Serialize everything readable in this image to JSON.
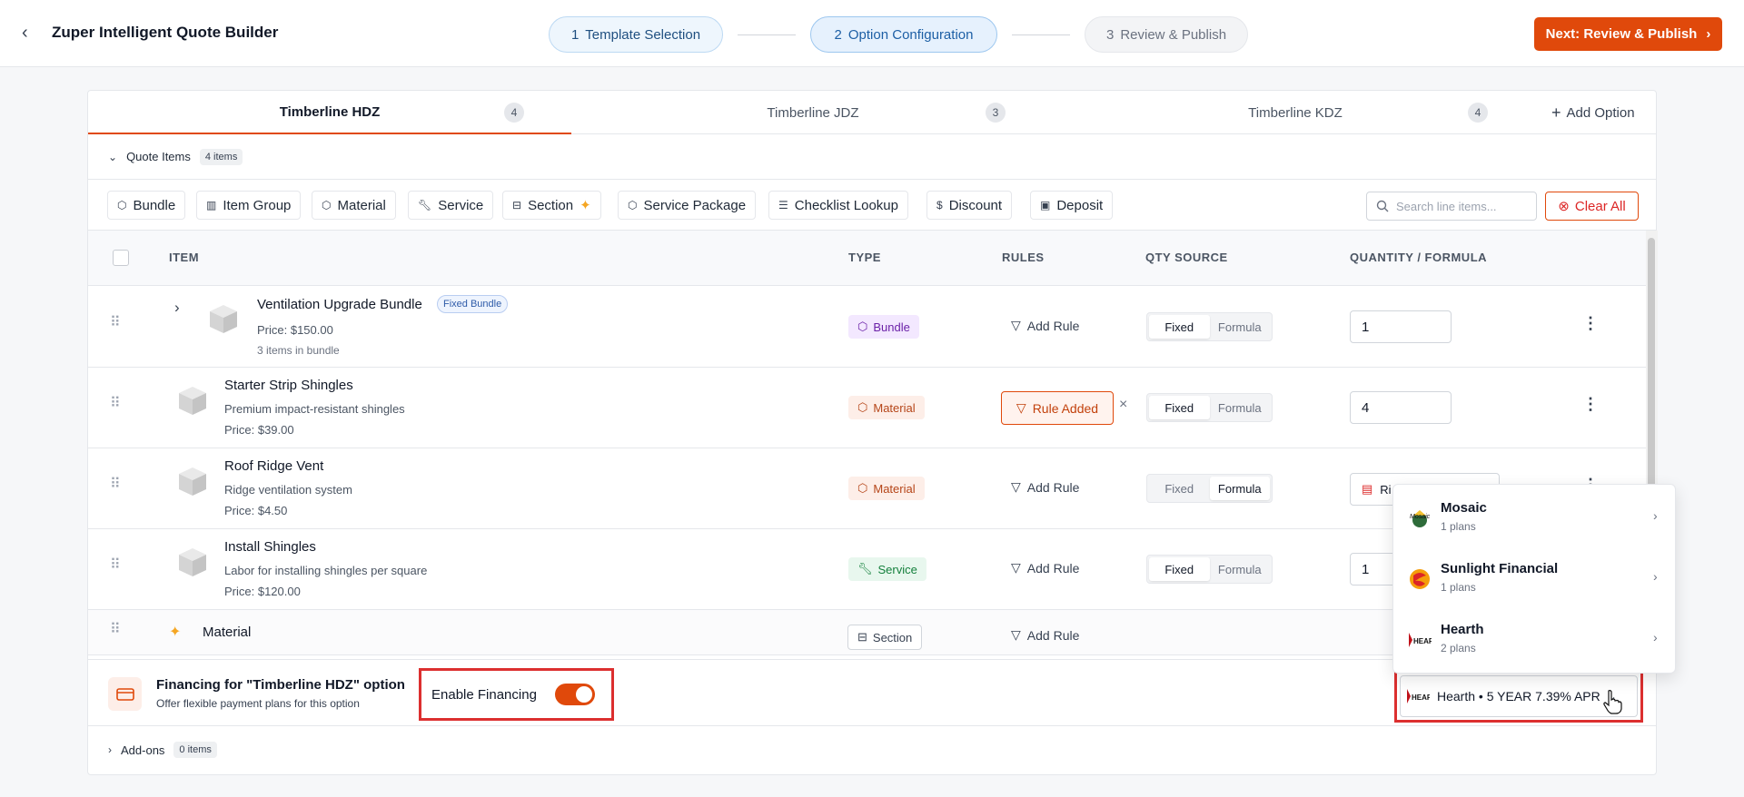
{
  "header": {
    "title": "Zuper Intelligent Quote Builder",
    "steps": [
      {
        "num": "1",
        "label": "Template Selection"
      },
      {
        "num": "2",
        "label": "Option Configuration"
      },
      {
        "num": "3",
        "label": "Review & Publish"
      }
    ],
    "next_button": "Next: Review & Publish"
  },
  "tabs": [
    {
      "label": "Timberline HDZ",
      "count": "4"
    },
    {
      "label": "Timberline JDZ",
      "count": "3"
    },
    {
      "label": "Timberline KDZ",
      "count": "4"
    }
  ],
  "add_option": "Add Option",
  "quote_items": {
    "label": "Quote Items",
    "count": "4 items"
  },
  "toolbar": [
    "Bundle",
    "Item Group",
    "Material",
    "Service",
    "Section",
    "Service Package",
    "Checklist Lookup",
    "Discount",
    "Deposit"
  ],
  "search": {
    "placeholder": "Search line items..."
  },
  "clear_all": "Clear All",
  "columns": [
    "ITEM",
    "TYPE",
    "RULES",
    "QTY SOURCE",
    "QUANTITY / FORMULA"
  ],
  "rows": [
    {
      "name": "Ventilation Upgrade Bundle",
      "badge": "Fixed Bundle",
      "price": "Price: $150.00",
      "sub": "3 items in bundle",
      "type": "Bundle",
      "rule": "Add Rule",
      "qty_source": "Fixed",
      "qty": "1"
    },
    {
      "name": "Starter Strip Shingles",
      "desc": "Premium impact-resistant shingles",
      "price": "Price: $39.00",
      "type": "Material",
      "rule": "Rule Added",
      "qty_source": "Fixed",
      "qty": "4"
    },
    {
      "name": "Roof Ridge Vent",
      "desc": "Ridge ventilation system",
      "price": "Price: $4.50",
      "type": "Material",
      "rule": "Add Rule",
      "qty_source": "Formula",
      "qty": "Ri"
    },
    {
      "name": "Install Shingles",
      "desc": "Labor for installing shingles per square",
      "price": "Price: $120.00",
      "type": "Service",
      "rule": "Add Rule",
      "qty_source": "Fixed",
      "qty": "1"
    }
  ],
  "qty_source_options": [
    "Fixed",
    "Formula"
  ],
  "section_row": {
    "name": "Material",
    "type": "Section",
    "rule": "Add Rule"
  },
  "financing": {
    "title": "Financing for \"Timberline HDZ\" option",
    "subtitle": "Offer flexible payment plans for this option",
    "enable_label": "Enable Financing",
    "enabled": true,
    "selected_plan": "Hearth • 5 YEAR 7.39% APR"
  },
  "lenders": [
    {
      "name": "Mosaic",
      "plans": "1 plans",
      "logo": "mosaic-logo"
    },
    {
      "name": "Sunlight Financial",
      "plans": "1 plans",
      "logo": "sunlight-logo"
    },
    {
      "name": "Hearth",
      "plans": "2 plans",
      "logo": "hearth-logo"
    }
  ],
  "logo_text": {
    "mosaic": "Mosaic",
    "hearth": "HEAR"
  },
  "addons": {
    "label": "Add-ons",
    "count": "0 items"
  },
  "colors": {
    "accent": "#e0490b",
    "highlight": "#dc2f2f",
    "link": "#1d5fa5"
  }
}
